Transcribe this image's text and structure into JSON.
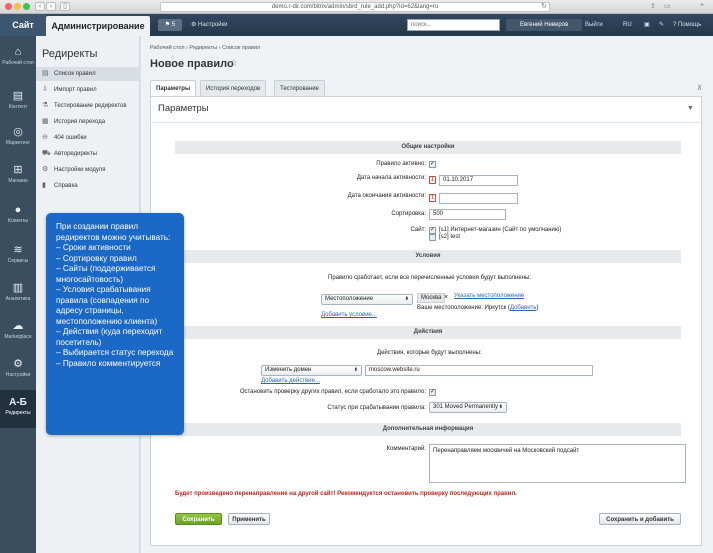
{
  "browser": {
    "url": "demo.r-dir.com/bitrix/admin/sbrd_rule_add.php?id=62&lang=ru"
  },
  "topbar": {
    "site_tab": "Сайт",
    "admin_tab": "Администрирование",
    "notifications": "5",
    "settings_label": "Настройки",
    "search_placeholder": "поиск...",
    "user_name": "Евгений Неверов",
    "logout": "Выйти",
    "lang": "RU",
    "help": "Помощь"
  },
  "iconbar": {
    "items": [
      {
        "label": "Рабочий стол",
        "icon": "home-icon"
      },
      {
        "label": "Контент",
        "icon": "document-icon"
      },
      {
        "label": "Маркетинг",
        "icon": "target-icon"
      },
      {
        "label": "Магазин",
        "icon": "cart-icon"
      },
      {
        "label": "Клиенты",
        "icon": "clients-icon"
      },
      {
        "label": "Сервисы",
        "icon": "layers-icon"
      },
      {
        "label": "Аналитика",
        "icon": "chart-icon"
      },
      {
        "label": "Marketplace",
        "icon": "cloud-icon"
      },
      {
        "label": "Настройки",
        "icon": "gear-icon"
      },
      {
        "label": "Редиректы",
        "icon": "redirects-icon",
        "glyph": "A-Б"
      }
    ]
  },
  "menu": {
    "title": "Редиректы",
    "items": [
      {
        "label": "Список правил"
      },
      {
        "label": "Импорт правил"
      },
      {
        "label": "Тестирование редиректов"
      },
      {
        "label": "История перехода"
      },
      {
        "label": "404 ошибки"
      },
      {
        "label": "Автоpедиректы"
      },
      {
        "label": "Настройки модуля"
      },
      {
        "label": "Справка"
      }
    ]
  },
  "callout": {
    "lines": [
      "При создании правил редиректов можно учитывать:",
      "– Сроки активности",
      "– Сортировку правил",
      "– Сайты (поддерживается многосайтовость)",
      "– Условия срабатывания правила (совпадения по адресу страницы, местоположению клиента)",
      "– Действия (куда переходит посетитель)",
      "– Выбирается статус перехода",
      "– Правило комментируется"
    ]
  },
  "main": {
    "breadcrumbs": "Рабочий стол  ›  Редиректы  ›  Список правил",
    "title": "Новое правило",
    "tabs": [
      {
        "label": "Параметры"
      },
      {
        "label": "История переходов"
      },
      {
        "label": "Тестирование"
      }
    ],
    "panel_title": "Параметры"
  },
  "general": {
    "section": "Общие настройки",
    "active_label": "Правило активно:",
    "start_label": "Дата начала активности:",
    "start_value": "01.10.2017",
    "end_label": "Дата окончания активности:",
    "end_value": "",
    "sort_label": "Сортировка:",
    "sort_value": "500",
    "site_label": "Сайт:",
    "site1": "[s1] Интернет-магазин (Сайт по умолчанию)",
    "site2": "[s2] test"
  },
  "conditions": {
    "section": "Условия",
    "intro": "Правило сработает, если все перечисленные условия будут выполнены:",
    "type": "Местоположение",
    "tag": "Москва",
    "tag_close": "×",
    "pick_link": "Указать местоположение",
    "your_location": "Ваше местоположение: Иркутск (",
    "add_link_inline": "Добавить",
    "your_location_end": ")",
    "add_condition": "Добавить условие..."
  },
  "actions": {
    "section": "Действия",
    "intro": "Действия, которые будут выполнены:",
    "type": "Изменить домен",
    "value": "moscow.website.ru",
    "add_action": "Добавить действие...",
    "stop_label": "Остановить проверку других правил, если сработало это правило:",
    "status_label": "Статус при срабатывании правила:",
    "status_value": "301 Moved Permanently"
  },
  "extra": {
    "section": "Дополнительная информация",
    "comment_label": "Комментарий:",
    "comment_value": "Перенаправляем москвичей на Московский подсайт"
  },
  "warning": "Будет произведено перенаправление на другой сайт! Рекомендуется остановить проверку последующих правил.",
  "buttons": {
    "save": "Сохранить",
    "apply": "Применить",
    "save_add": "Сохранить и добавить"
  }
}
